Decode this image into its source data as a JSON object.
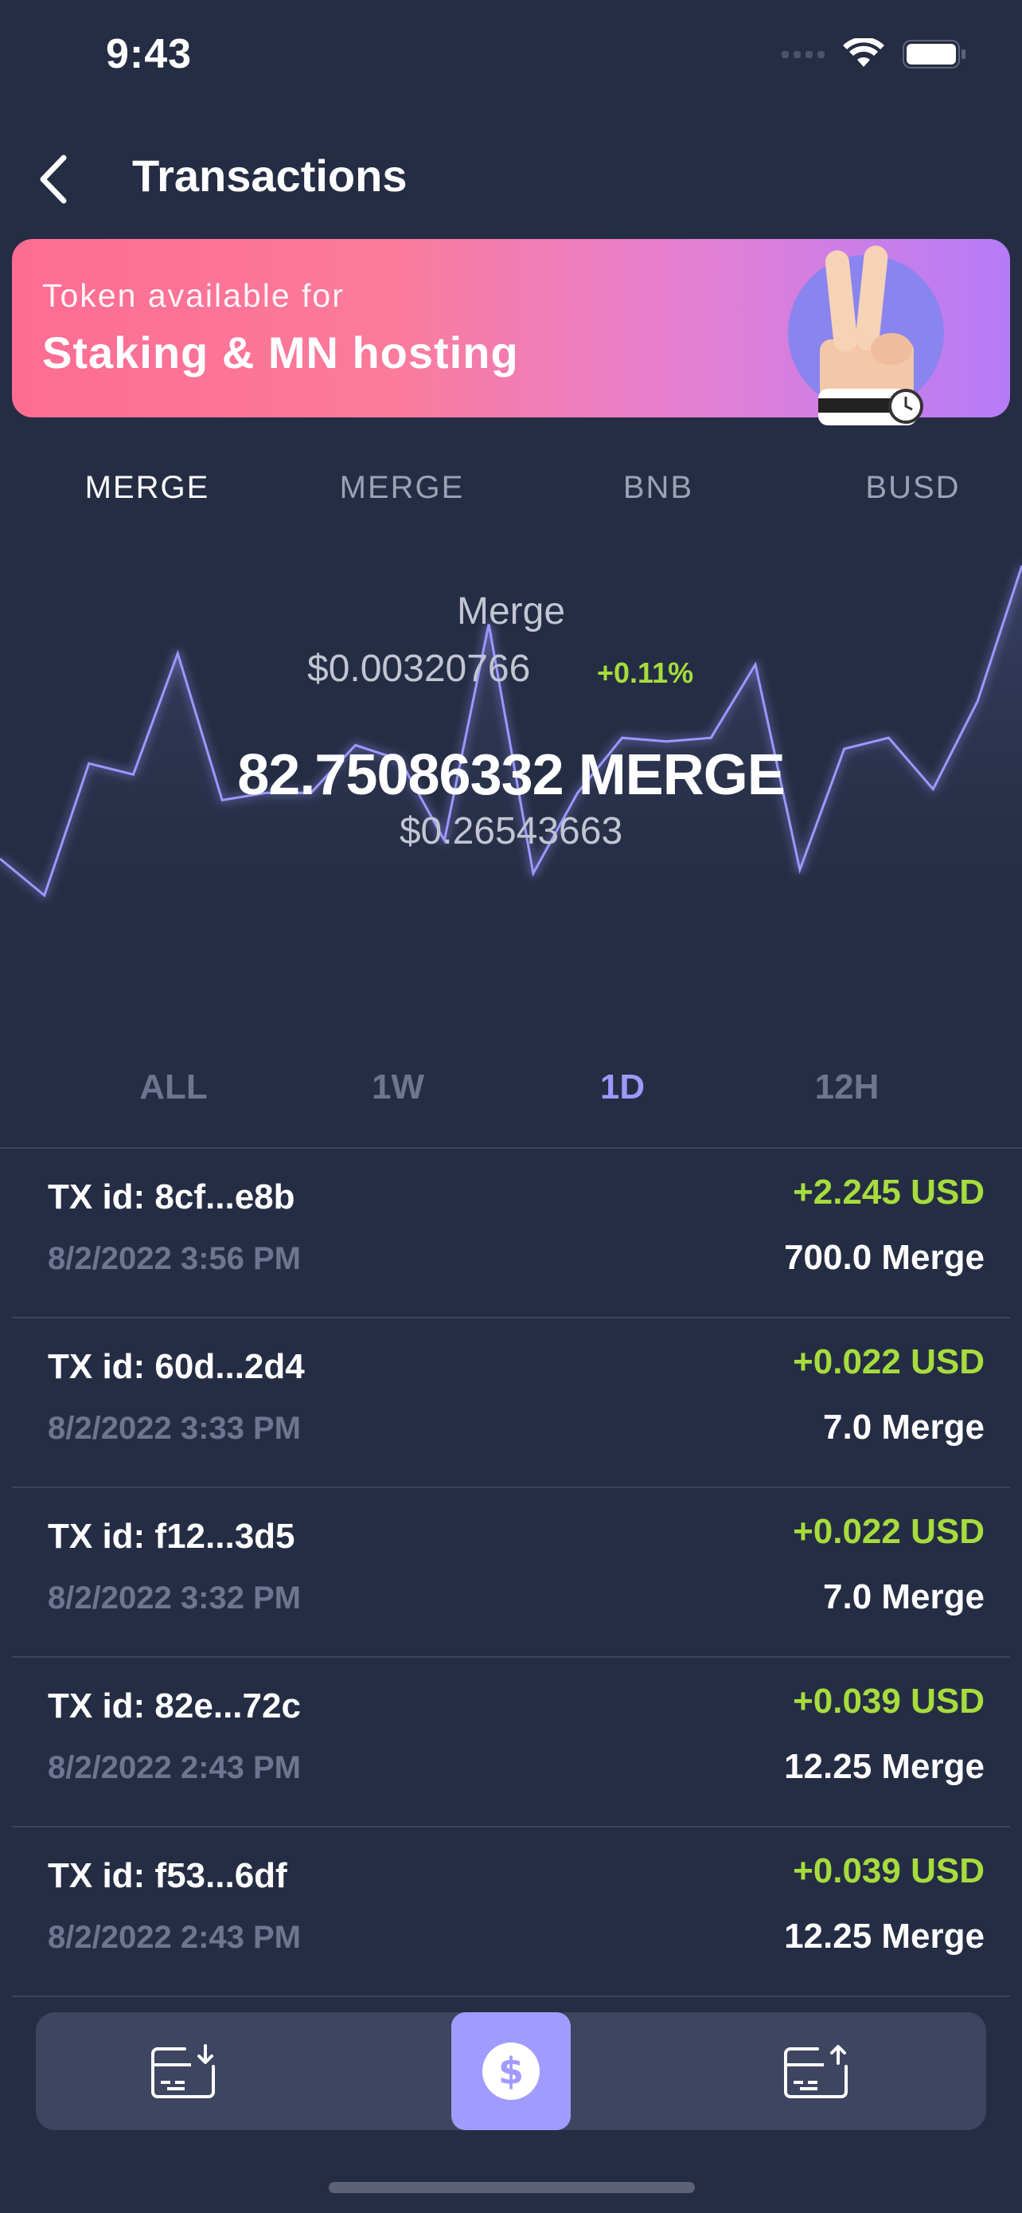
{
  "status_bar": {
    "time": "9:43"
  },
  "header": {
    "title": "Transactions",
    "back_icon": "chevron-left-icon"
  },
  "banner": {
    "subtitle": "Token available for",
    "title": "Staking & MN hosting"
  },
  "token_tabs": [
    {
      "label": "MERGE",
      "active": true
    },
    {
      "label": "MERGE",
      "active": false
    },
    {
      "label": "BNB",
      "active": false
    },
    {
      "label": "BUSD",
      "active": false
    }
  ],
  "coin": {
    "name": "Merge",
    "price": "$0.00320766",
    "change": "+0.11%",
    "balance": "82.75086332 MERGE",
    "balance_usd": "$0.26543663"
  },
  "chart_data": {
    "type": "line",
    "values": [
      0.2,
      0.1,
      0.46,
      0.43,
      0.76,
      0.36,
      0.38,
      0.38,
      0.51,
      0.47,
      0.25,
      0.84,
      0.16,
      0.38,
      0.53,
      0.52,
      0.53,
      0.73,
      0.17,
      0.5,
      0.53,
      0.39,
      0.63,
      1.0
    ],
    "colors": {
      "line": "#9b98ff",
      "fill_top": "#3a4266",
      "fill_bottom": "#252d44"
    }
  },
  "periods": [
    {
      "label": "ALL",
      "active": false
    },
    {
      "label": "1W",
      "active": false
    },
    {
      "label": "1D",
      "active": true
    },
    {
      "label": "12H",
      "active": false
    }
  ],
  "transactions": [
    {
      "id": "TX id: 8cf...e8b",
      "date": "8/2/2022 3:56 PM",
      "usd": "+2.245 USD",
      "amount": "700.0 Merge"
    },
    {
      "id": "TX id: 60d...2d4",
      "date": "8/2/2022 3:33 PM",
      "usd": "+0.022 USD",
      "amount": "7.0 Merge"
    },
    {
      "id": "TX id: f12...3d5",
      "date": "8/2/2022 3:32 PM",
      "usd": "+0.022 USD",
      "amount": "7.0 Merge"
    },
    {
      "id": "TX id: 82e...72c",
      "date": "8/2/2022 2:43 PM",
      "usd": "+0.039 USD",
      "amount": "12.25 Merge"
    },
    {
      "id": "TX id: f53...6df",
      "date": "8/2/2022 2:43 PM",
      "usd": "+0.039 USD",
      "amount": "12.25 Merge"
    }
  ],
  "tabbar": {
    "items": [
      {
        "icon": "wallet-receive-icon",
        "active": false
      },
      {
        "icon": "dollar-icon",
        "active": true
      },
      {
        "icon": "wallet-send-icon",
        "active": false
      }
    ],
    "accent": "#a29bff"
  }
}
